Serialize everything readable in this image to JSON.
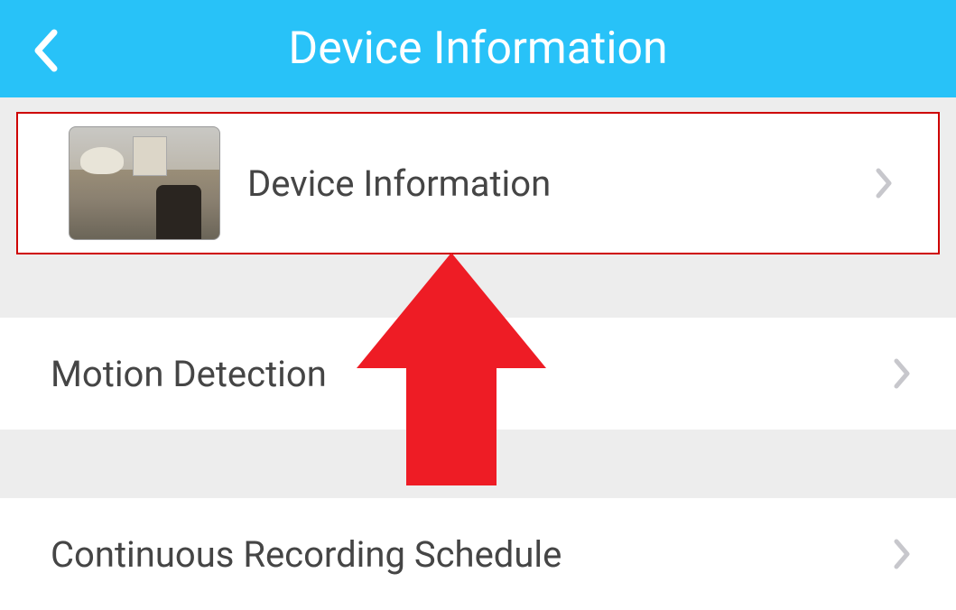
{
  "header": {
    "title": "Device Information"
  },
  "items": [
    {
      "label": "Device Information",
      "has_thumbnail": true
    },
    {
      "label": "Motion Detection",
      "has_thumbnail": false
    },
    {
      "label": "Continuous Recording Schedule",
      "has_thumbnail": false
    }
  ],
  "colors": {
    "header_bg": "#28c2f8",
    "highlight_border": "#ce0000",
    "arrow": "#ee1c25",
    "chevron": "#c7c7cc"
  }
}
